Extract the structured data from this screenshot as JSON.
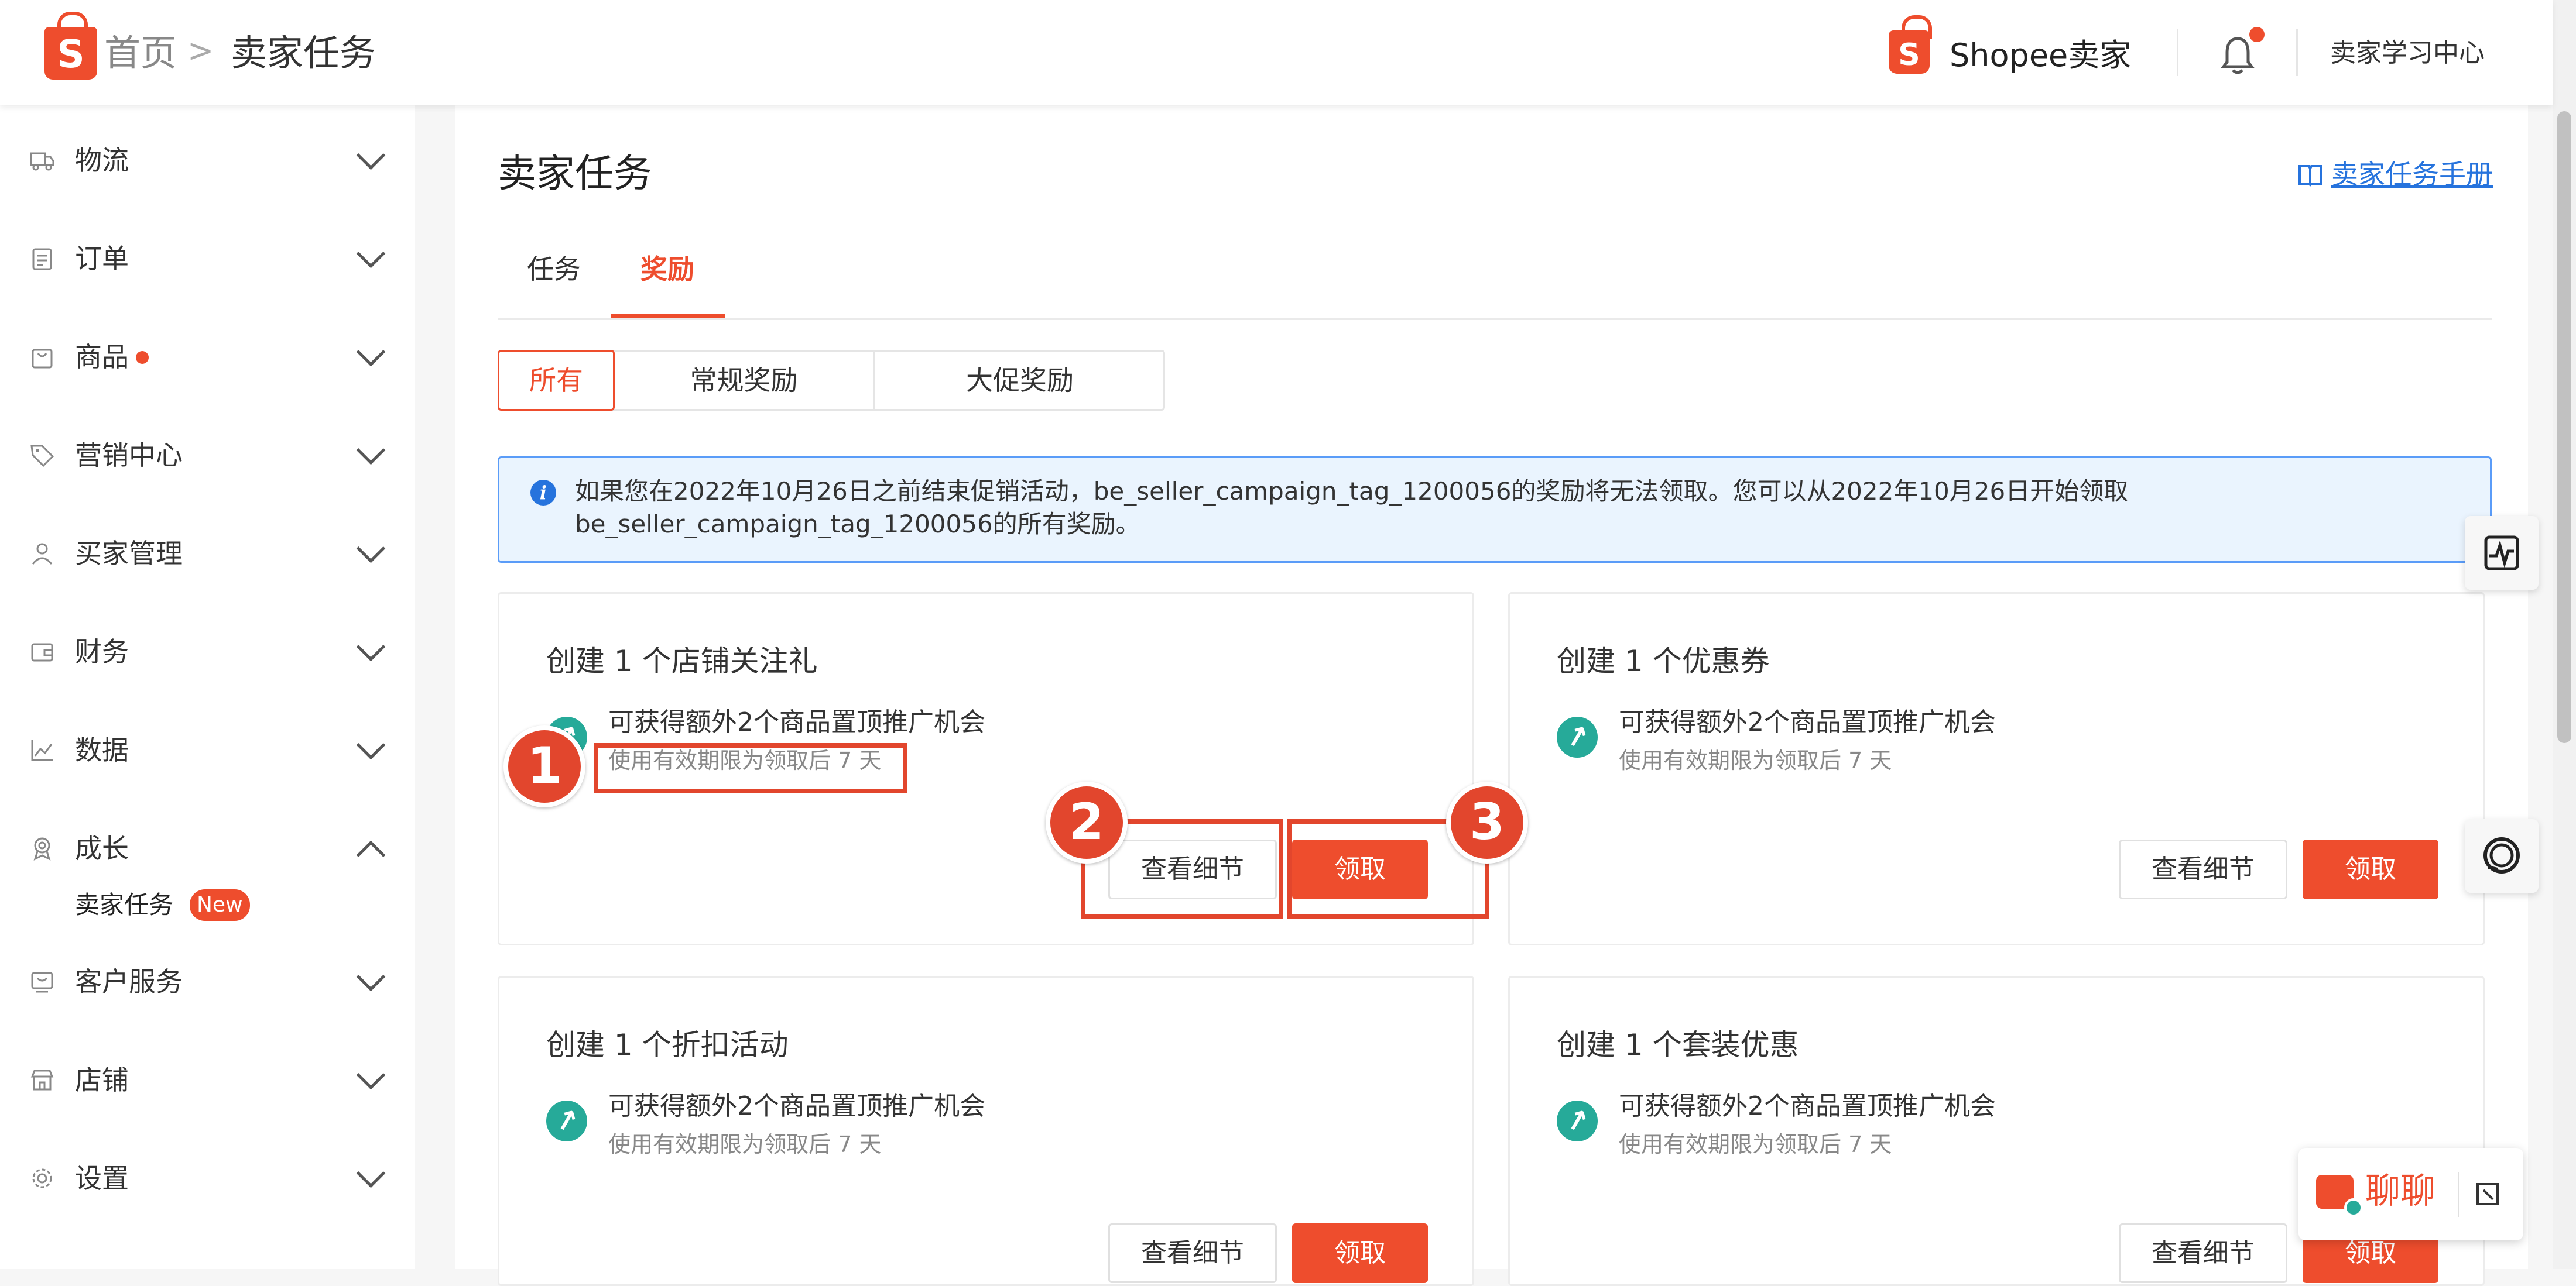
{
  "header": {
    "logo_letter": "S",
    "breadcrumb_home": "首页",
    "breadcrumb_separator": ">",
    "breadcrumb_current": "卖家任务",
    "brand_name": "Shopee卖家",
    "learning_center": "卖家学习中心"
  },
  "sidebar": {
    "items": [
      {
        "label": "物流",
        "icon": "truck-icon"
      },
      {
        "label": "订单",
        "icon": "clipboard-icon"
      },
      {
        "label": "商品",
        "icon": "bag-icon",
        "dot": true
      },
      {
        "label": "营销中心",
        "icon": "tag-icon"
      },
      {
        "label": "买家管理",
        "icon": "user-icon"
      },
      {
        "label": "财务",
        "icon": "wallet-icon"
      },
      {
        "label": "数据",
        "icon": "chart-icon"
      },
      {
        "label": "成长",
        "icon": "medal-icon",
        "expanded": true
      },
      {
        "label": "客户服务",
        "icon": "service-icon"
      },
      {
        "label": "店铺",
        "icon": "shop-icon"
      },
      {
        "label": "设置",
        "icon": "gear-icon"
      }
    ],
    "sub_item": {
      "label": "卖家任务",
      "badge": "New"
    }
  },
  "page": {
    "title": "卖家任务",
    "manual_link": "卖家任务手册",
    "tabs": [
      "任务",
      "奖励"
    ],
    "active_tab": "奖励",
    "filters": [
      "所有",
      "常规奖励",
      "大促奖励"
    ],
    "active_filter": "所有",
    "notice_line1": "如果您在2022年10月26日之前结束促销活动，be_seller_campaign_tag_1200056的奖励将无法领取。您可以从2022年10月26日开始领取",
    "notice_line2": "be_seller_campaign_tag_1200056的所有奖励。"
  },
  "cards": [
    {
      "title": "创建 1 个店铺关注礼",
      "reward": "可获得额外2个商品置顶推广机会",
      "validity": "使用有效期限为领取后 7 天",
      "detail_label": "查看细节",
      "claim_label": "领取"
    },
    {
      "title": "创建 1 个优惠券",
      "reward": "可获得额外2个商品置顶推广机会",
      "validity": "使用有效期限为领取后 7 天",
      "detail_label": "查看细节",
      "claim_label": "领取"
    },
    {
      "title": "创建 1 个折扣活动",
      "reward": "可获得额外2个商品置顶推广机会",
      "validity": "使用有效期限为领取后 7 天",
      "detail_label": "查看细节",
      "claim_label": "领取"
    },
    {
      "title": "创建 1 个套装优惠",
      "reward": "可获得额外2个商品置顶推广机会",
      "validity": "使用有效期限为领取后 7 天",
      "detail_label": "查看细节",
      "claim_label": "领取"
    }
  ],
  "annotations": [
    "1",
    "2",
    "3"
  ],
  "chat": {
    "label": "聊聊"
  },
  "colors": {
    "accent": "#ee4d2d",
    "teal": "#26aa99",
    "link": "#2673dd",
    "notice_bg": "#eaf4fe",
    "notice_border": "#5a9cf8"
  }
}
